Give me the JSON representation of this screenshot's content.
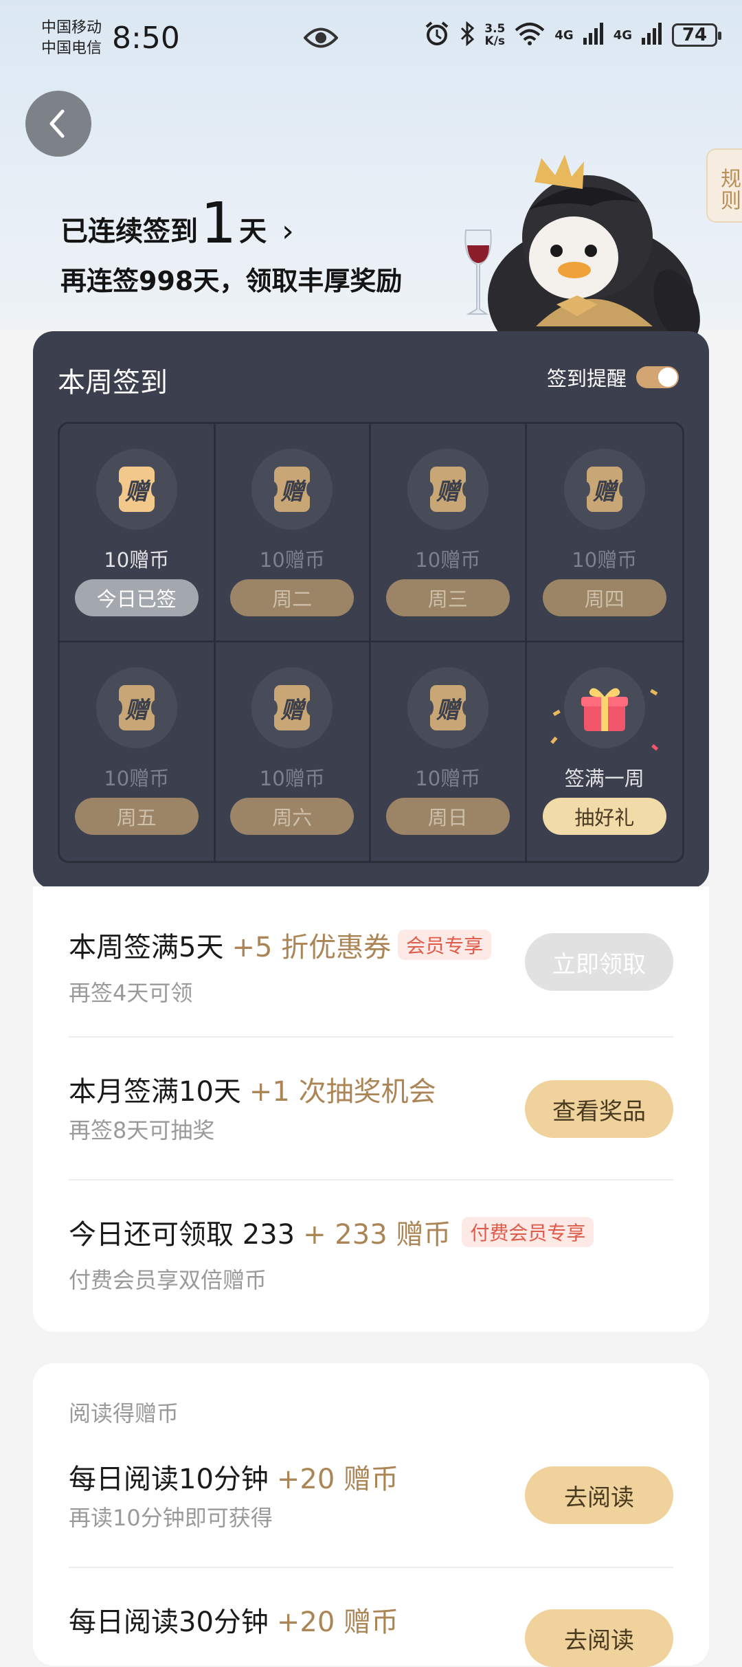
{
  "status": {
    "carrier1": "中国移动",
    "carrier2": "中国电信",
    "time": "8:50",
    "speed_value": "3.5",
    "speed_unit": "K/s",
    "net1": "4G",
    "net2": "4G",
    "battery": "74"
  },
  "header": {
    "rules_label": "规则",
    "streak_prefix": "已连续签到",
    "streak_days": "1",
    "streak_suffix": "天",
    "streak_chevron": "›",
    "subtitle": "再连签998天，领取丰厚奖励"
  },
  "week": {
    "title": "本周签到",
    "reminder_label": "签到提醒",
    "reminder_on": true,
    "days": [
      {
        "coin": "10赠币",
        "label": "今日已签",
        "state": "done"
      },
      {
        "coin": "10赠币",
        "label": "周二",
        "state": "pending"
      },
      {
        "coin": "10赠币",
        "label": "周三",
        "state": "pending"
      },
      {
        "coin": "10赠币",
        "label": "周四",
        "state": "pending"
      },
      {
        "coin": "10赠币",
        "label": "周五",
        "state": "pending"
      },
      {
        "coin": "10赠币",
        "label": "周六",
        "state": "pending"
      },
      {
        "coin": "10赠币",
        "label": "周日",
        "state": "pending"
      }
    ],
    "gift": {
      "label": "签满一周",
      "button": "抽好礼"
    },
    "coin_glyph": "赠"
  },
  "tasks": [
    {
      "title": "本周签满5天",
      "reward": "+5 折优惠券",
      "tag": "会员专享",
      "sub": "再签4天可领",
      "button": "立即领取",
      "enabled": false
    },
    {
      "title": "本月签满10天",
      "reward": "+1 次抽奖机会",
      "tag": "",
      "sub": "再签8天可抽奖",
      "button": "查看奖品",
      "enabled": true
    },
    {
      "title": "今日还可领取 233",
      "reward": "+ 233 赠币",
      "tag": "付费会员专享",
      "sub": "付费会员享双倍赠币",
      "button": "",
      "enabled": false
    }
  ],
  "reading": {
    "section_title": "阅读得赠币",
    "items": [
      {
        "title": "每日阅读10分钟",
        "reward": "+20 赠币",
        "sub": "再读10分钟即可获得",
        "button": "去阅读"
      },
      {
        "title": "每日阅读30分钟",
        "reward": "+20 赠币",
        "sub": "",
        "button": "去阅读"
      }
    ]
  },
  "colors": {
    "card_dark": "#3c404e",
    "accent_gold": "#ab8556",
    "button_gold": "#efd29c",
    "tag_red": "#e05a4a"
  }
}
